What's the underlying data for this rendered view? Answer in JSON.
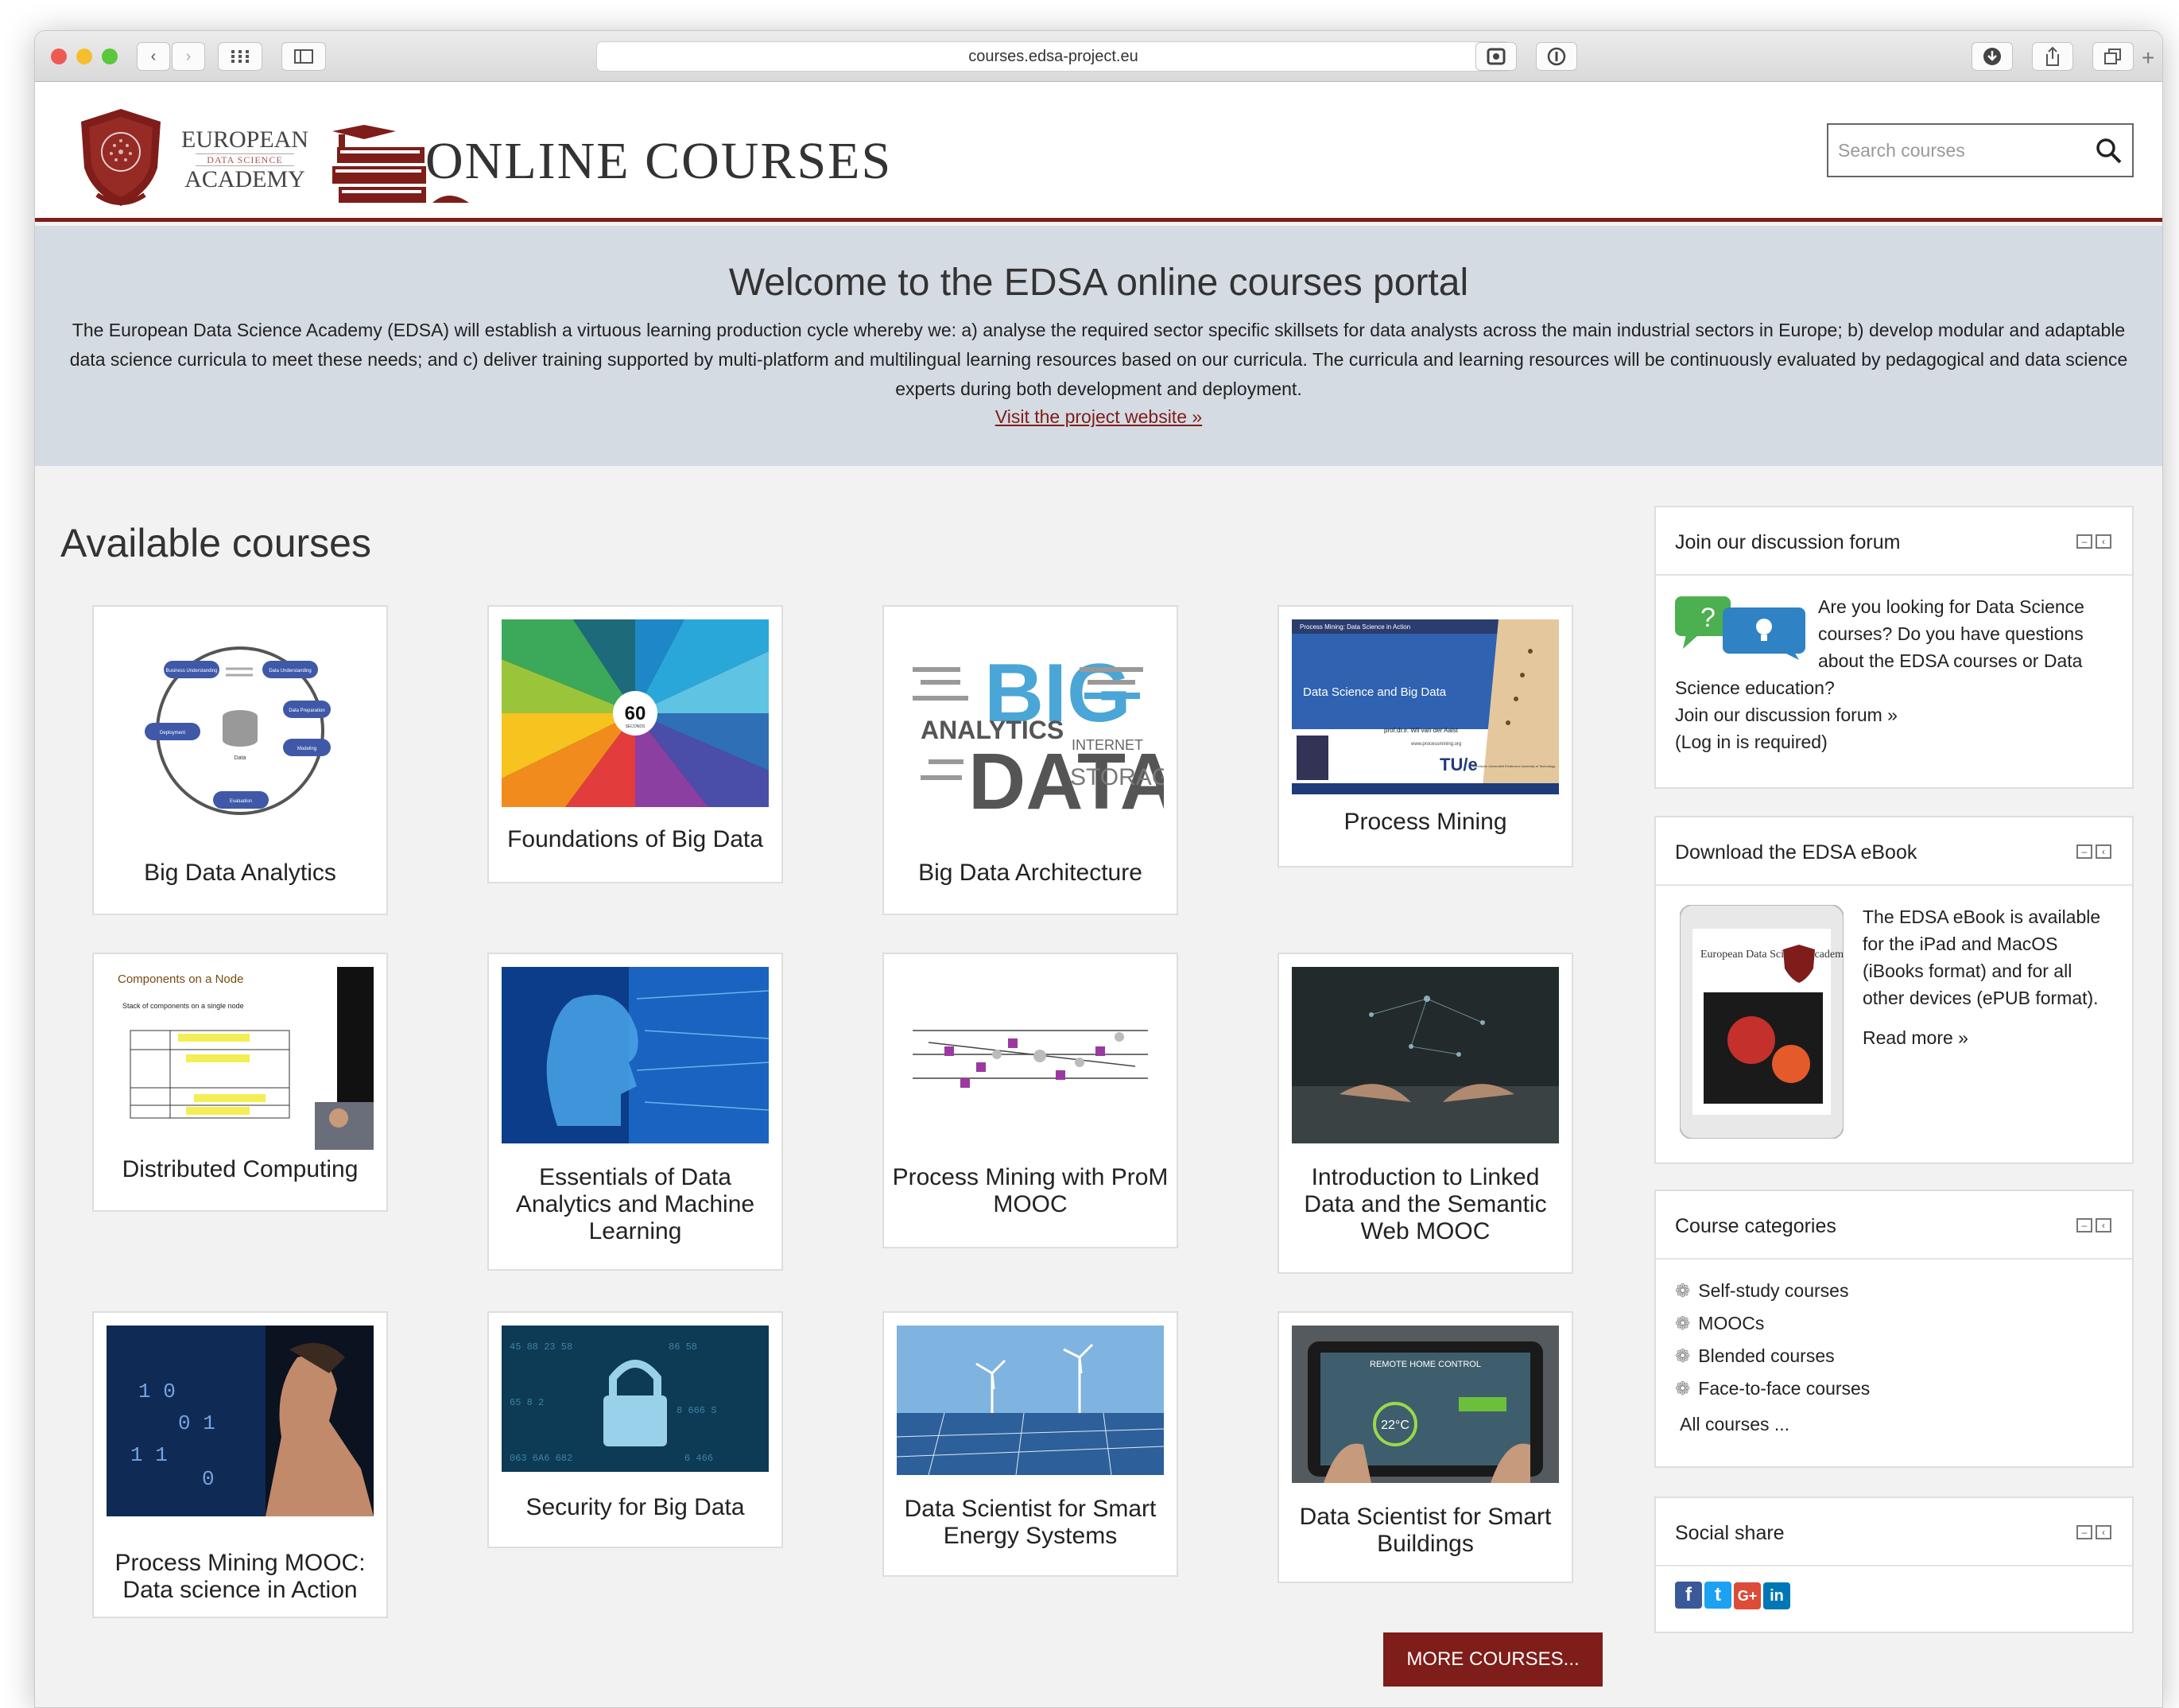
{
  "browser": {
    "url": "courses.edsa-project.eu",
    "traffic_colors": [
      "#ee5a52",
      "#f6be2f",
      "#5bc83b"
    ]
  },
  "header": {
    "academy_line1": "EUROPEAN",
    "academy_line2": "DATA SCIENCE",
    "academy_line3": "ACADEMY",
    "site_title": "ONLINE COURSES",
    "search_placeholder": "Search courses",
    "accent_color": "#7e1d19"
  },
  "hero": {
    "title": "Welcome to the EDSA online courses portal",
    "text": "The European Data Science Academy (EDSA) will establish a virtuous learning production cycle whereby we: a) analyse the required sector specific skillsets for data analysts across the main industrial sectors in Europe; b) develop modular and adaptable data science curricula to meet these needs; and c) deliver training supported by multi-platform and multilingual learning resources based on our curricula. The curricula and learning resources will be continuously evaluated by pedagogical and data science experts during both development and deployment.",
    "link": "Visit the project website »"
  },
  "courses": {
    "heading": "Available courses",
    "items": [
      {
        "title": "Big Data Analytics"
      },
      {
        "title": "Foundations of Big Data"
      },
      {
        "title": "Big Data Architecture"
      },
      {
        "title": "Process Mining"
      },
      {
        "title": "Distributed Computing"
      },
      {
        "title": "Essentials of Data Analytics and Machine Learning"
      },
      {
        "title": "Process Mining with ProM MOOC"
      },
      {
        "title": "Introduction to Linked Data and the Semantic Web MOOC"
      },
      {
        "title": "Process Mining MOOC: Data science in Action"
      },
      {
        "title": "Security for Big Data"
      },
      {
        "title": "Data Scientist for Smart Energy Systems"
      },
      {
        "title": "Data Scientist for Smart Buildings"
      }
    ],
    "more_button": "MORE COURSES..."
  },
  "thumb_text": {
    "infographic_number": "60",
    "infographic_label": "SECONDS",
    "big": "BIG",
    "data": "DATA",
    "analytics": "ANALYTICS",
    "storage": "STORAGE",
    "internet": "INTERNET",
    "pm_header": "Process Mining: Data Science in Action",
    "pm_title": "Data Science and Big Data",
    "pm_author": "prof.dr.ir. Wil van der Aalst",
    "pm_site": "www.processmining.org",
    "tue": "TU/e",
    "tue_sub": "Technische Universiteit Eindhoven University of Technology",
    "node_title": "Components on a Node",
    "node_bullet": "Stack of components on a single node",
    "remote": "REMOTE HOME CONTROL",
    "temp": "22°C",
    "book_title": "European Data Science Academy",
    "crisp_labels": [
      "Business Understanding",
      "Data Understanding",
      "Data Preparation",
      "Modeling",
      "Evaluation",
      "Deployment",
      "Data"
    ]
  },
  "sidebar": {
    "forum": {
      "title": "Join our discussion forum",
      "text": "Are you looking for Data Science courses? Do you have questions about the EDSA courses or Data Science education?",
      "link": "Join our discussion forum »",
      "note": "(Log in is required)"
    },
    "ebook": {
      "title": "Download the EDSA eBook",
      "text": "The EDSA eBook is available for the iPad and MacOS (iBooks format) and for all other devices (ePUB format).",
      "link": "Read more »"
    },
    "categories": {
      "title": "Course categories",
      "items": [
        {
          "label": "Self-study courses"
        },
        {
          "label": "MOOCs"
        },
        {
          "label": "Blended courses"
        },
        {
          "label": "Face-to-face courses"
        }
      ],
      "all": "All courses ..."
    },
    "social": {
      "title": "Social share",
      "items": [
        {
          "icon": "facebook-icon",
          "glyph": "f",
          "color": "#3b5998"
        },
        {
          "icon": "twitter-icon",
          "glyph": "t",
          "color": "#1da1f2"
        },
        {
          "icon": "google-plus-icon",
          "glyph": "G+",
          "color": "#dd4b39"
        },
        {
          "icon": "linkedin-icon",
          "glyph": "in",
          "color": "#0077b5"
        }
      ]
    }
  }
}
